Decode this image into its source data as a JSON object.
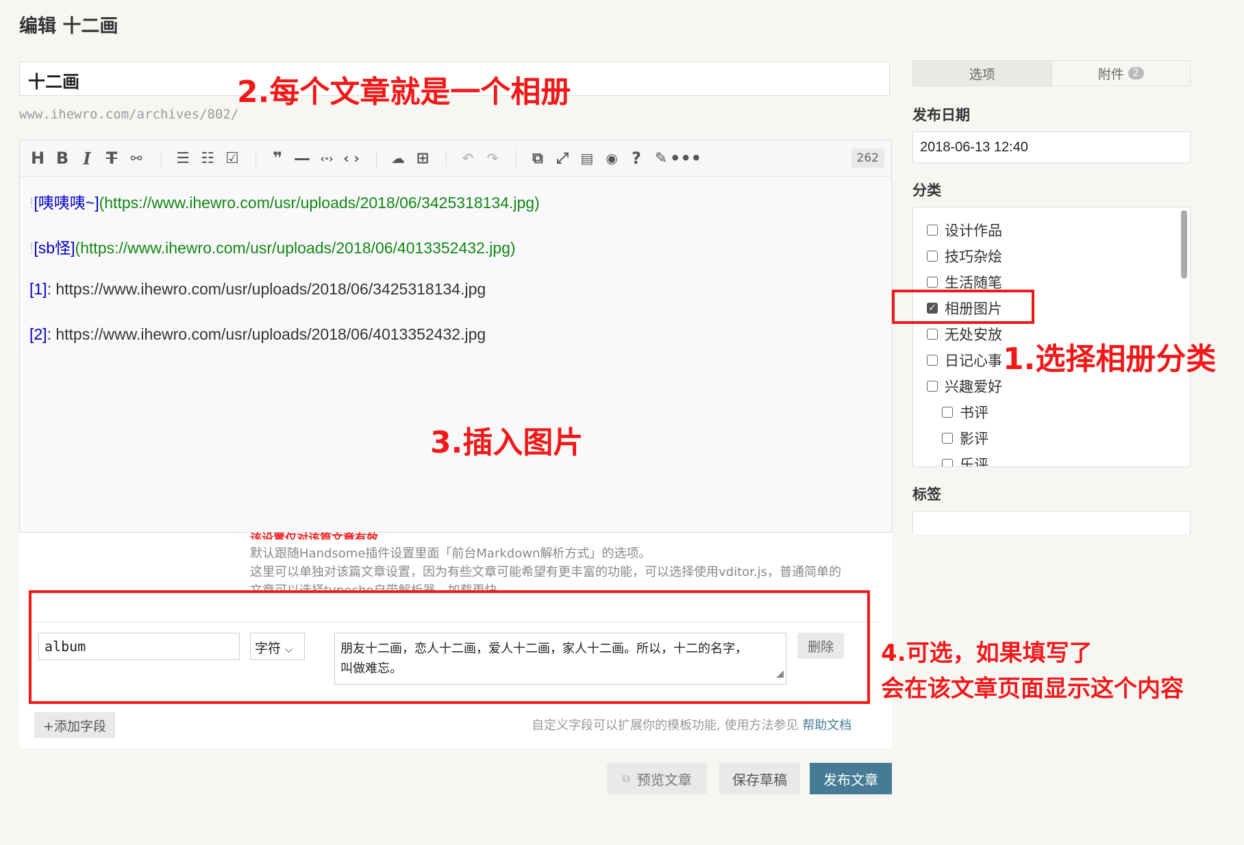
{
  "page_title": "编辑 十二画",
  "title_value": "十二画",
  "permalink": "www.ihewro.com/archives/802/",
  "word_count": "262",
  "content_lines": [
    {
      "bang": "!",
      "alt": "[咦咦咦~]",
      "url": "(https://www.ihewro.com/usr/uploads/2018/06/3425318134.jpg)"
    },
    {
      "bang": "!",
      "alt": "[sb怪]",
      "url": "(https://www.ihewro.com/usr/uploads/2018/06/4013352432.jpg)"
    },
    {
      "ref": "[1]",
      "rest": ": https://www.ihewro.com/usr/uploads/2018/06/3425318134.jpg"
    },
    {
      "ref": "[2]",
      "rest": ": https://www.ihewro.com/usr/uploads/2018/06/4013352432.jpg"
    }
  ],
  "custom_notes": {
    "red": "该设置仅对该篇文章有效",
    "line1": "默认跟随Handsome插件设置里面「前台Markdown解析方式」的选项。",
    "line2": "这里可以单独对该篇文章设置，因为有些文章可能希望有更丰富的功能，可以选择使用vditor.js，普通简单的",
    "line3": "文章可以选择typecho自带解析器，加载更快"
  },
  "custom_field": {
    "name": "album",
    "type": "字符",
    "value_line1": "朋友十二画，恋人十二画，爱人十二画，家人十二画。所以，十二的名字，",
    "value_line2": "叫做难忘。",
    "delete_label": "删除"
  },
  "add_field_label": "+添加字段",
  "help_text": "自定义字段可以扩展你的模板功能, 使用方法参见",
  "help_link": "帮助文档",
  "buttons": {
    "preview": "预览文章",
    "save": "保存草稿",
    "publish": "发布文章"
  },
  "sidebar": {
    "tabs": [
      {
        "label": "选项"
      },
      {
        "label": "附件",
        "badge": "2"
      }
    ],
    "publish_date_label": "发布日期",
    "publish_date": "2018-06-13 12:40",
    "category_label": "分类",
    "categories": [
      {
        "label": "设计作品",
        "checked": false
      },
      {
        "label": "技巧杂烩",
        "checked": false
      },
      {
        "label": "生活随笔",
        "checked": false
      },
      {
        "label": "相册图片",
        "checked": true
      },
      {
        "label": "无处安放",
        "checked": false
      },
      {
        "label": "日记心事",
        "checked": false
      },
      {
        "label": "兴趣爱好",
        "checked": false
      },
      {
        "label": "书评",
        "checked": false
      },
      {
        "label": "影评",
        "checked": false
      },
      {
        "label": "乐评",
        "checked": false
      }
    ],
    "tag_label": "标签"
  },
  "annotations": {
    "a1": "1.选择相册分类",
    "a2": "2.每个文章就是一个相册",
    "a3": "3.插入图片",
    "a4_line1": "4.可选，如果填写了",
    "a4_line2": "会在该文章页面显示这个内容"
  },
  "colors": {
    "annotation": "#f21818",
    "publish": "#467b96",
    "link_alt": "#0000cc",
    "link_url": "#118811"
  }
}
